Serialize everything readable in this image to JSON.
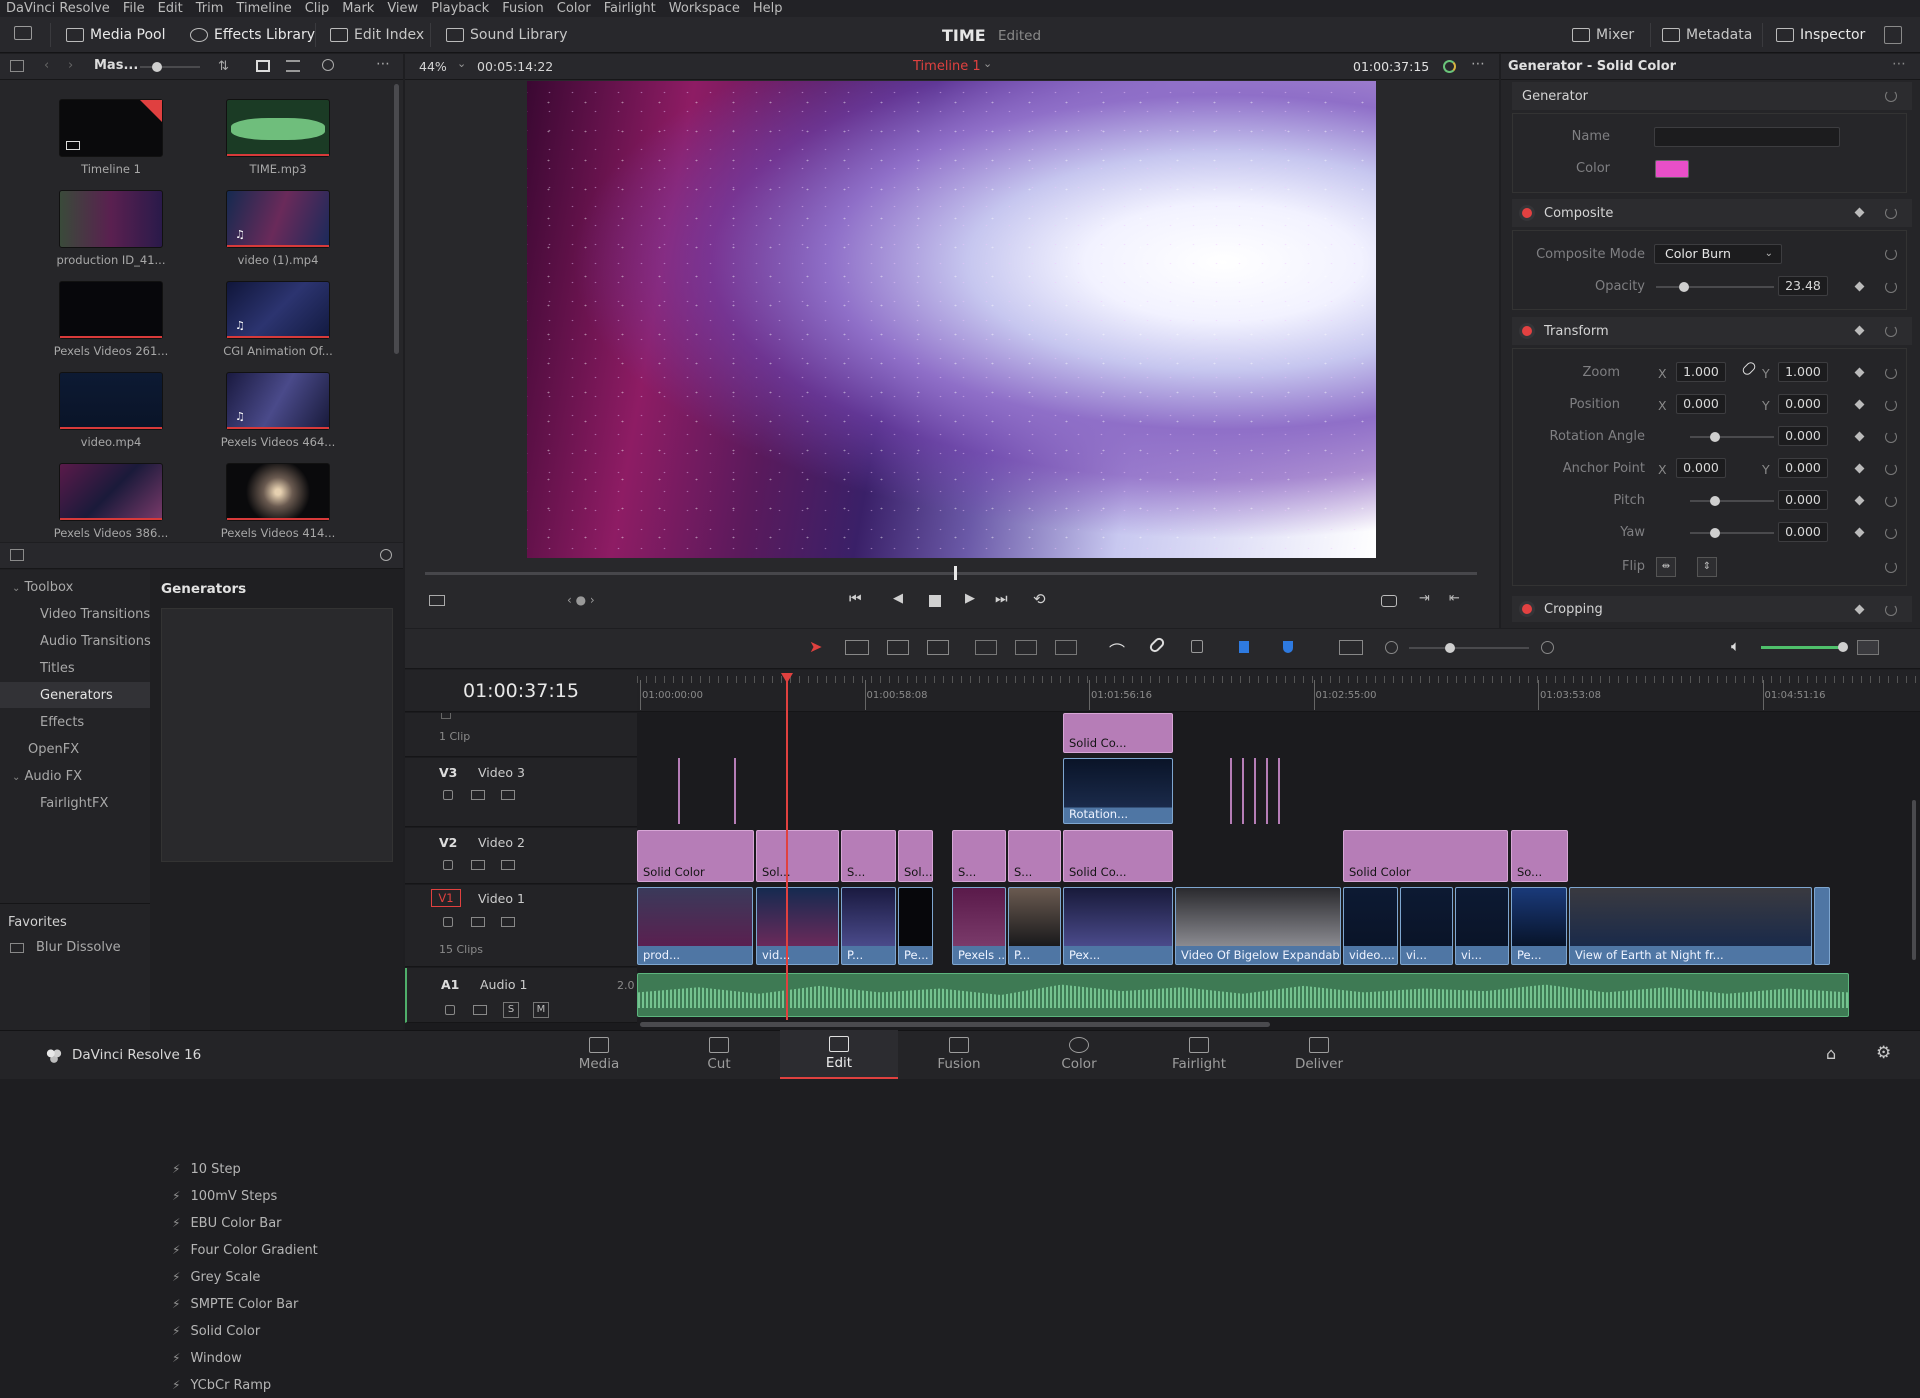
{
  "menu": [
    "DaVinci Resolve",
    "File",
    "Edit",
    "Trim",
    "Timeline",
    "Clip",
    "Mark",
    "View",
    "Playback",
    "Fusion",
    "Color",
    "Fairlight",
    "Workspace",
    "Help"
  ],
  "toolbar": {
    "media_pool": "Media Pool",
    "effects_library": "Effects Library",
    "edit_index": "Edit Index",
    "sound_library": "Sound Library",
    "project_title": "TIME",
    "project_status": "Edited",
    "mixer": "Mixer",
    "metadata": "Metadata",
    "inspector": "Inspector"
  },
  "media_pool": {
    "bin_label": "Mas...",
    "items": [
      {
        "name": "Timeline 1"
      },
      {
        "name": "TIME.mp3"
      },
      {
        "name": "production ID_41..."
      },
      {
        "name": "video (1).mp4"
      },
      {
        "name": "Pexels Videos 261..."
      },
      {
        "name": "CGI Animation Of..."
      },
      {
        "name": "video.mp4"
      },
      {
        "name": "Pexels Videos 464..."
      },
      {
        "name": "Pexels Videos 386..."
      },
      {
        "name": "Pexels Videos 414..."
      }
    ]
  },
  "effects": {
    "tree": {
      "toolbox": "Toolbox",
      "video_transitions": "Video Transitions",
      "audio_transitions": "Audio Transitions",
      "titles": "Titles",
      "generators": "Generators",
      "effects": "Effects",
      "openfx": "OpenFX",
      "audio_fx": "Audio FX",
      "fairlightfx": "FairlightFX"
    },
    "list_title": "Generators",
    "list": [
      "10 Step",
      "100mV Steps",
      "EBU Color Bar",
      "Four Color Gradient",
      "Grey Scale",
      "SMPTE Color Bar",
      "Solid Color",
      "Window",
      "YCbCr Ramp"
    ],
    "favorites_title": "Favorites",
    "favorites": [
      "Blur Dissolve"
    ]
  },
  "viewer": {
    "zoom": "44%",
    "duration": "00:05:14:22",
    "timeline_name": "Timeline 1",
    "timecode": "01:00:37:15",
    "scrub_position": 0.118
  },
  "inspector": {
    "title": "Generator - Solid Color",
    "generator": {
      "header": "Generator",
      "name_label": "Name",
      "name_value": "",
      "color_label": "Color",
      "color": "#e84fc8"
    },
    "composite": {
      "header": "Composite",
      "mode_label": "Composite Mode",
      "mode_value": "Color Burn",
      "opacity_label": "Opacity",
      "opacity_value": "23.48"
    },
    "transform": {
      "header": "Transform",
      "zoom_label": "Zoom",
      "zoom_x": "1.000",
      "zoom_y": "1.000",
      "position_label": "Position",
      "position_x": "0.000",
      "position_y": "0.000",
      "rotation_label": "Rotation Angle",
      "rotation_value": "0.000",
      "anchor_label": "Anchor Point",
      "anchor_x": "0.000",
      "anchor_y": "0.000",
      "pitch_label": "Pitch",
      "pitch_value": "0.000",
      "yaw_label": "Yaw",
      "yaw_value": "0.000",
      "flip_label": "Flip",
      "x": "X",
      "y": "Y"
    },
    "cropping": {
      "header": "Cropping"
    }
  },
  "timeline": {
    "timecode": "01:00:37:15",
    "ruler": [
      "01:00:00:00",
      "01:00:58:08",
      "01:01:56:16",
      "01:02:55:00",
      "01:03:53:08",
      "01:04:51:16"
    ],
    "tracks": {
      "v4_info": "1 Clip",
      "v3_id": "V3",
      "v3_name": "Video 3",
      "v2_id": "V2",
      "v2_name": "Video 2",
      "v1_id": "V1",
      "v1_name": "Video 1",
      "v1_info": "15 Clips",
      "a1_id": "A1",
      "a1_name": "Audio 1",
      "a1_level": "2.0",
      "solo": "S",
      "mute": "M"
    },
    "clips": {
      "v4": [
        "Solid Co..."
      ],
      "v3": [
        "Rotation..."
      ],
      "v2": [
        "Solid Color",
        "Sol...",
        "S...",
        "Sol...",
        "S...",
        "S...",
        "Solid Co...",
        "Solid Color",
        "So..."
      ],
      "v1": [
        "prod...",
        "vid...",
        "P...",
        "Pe...",
        "Pexels ...",
        "P...",
        "Pex...",
        "Video Of Bigelow Expandabl...",
        "video....",
        "vi...",
        "vi...",
        "Pe...",
        "View of Earth at Night fr..."
      ]
    }
  },
  "pages": [
    "Media",
    "Cut",
    "Edit",
    "Fusion",
    "Color",
    "Fairlight",
    "Deliver"
  ],
  "app_name": "DaVinci Resolve 16",
  "colors": {
    "accent_red": "#e0413f",
    "clip_pink": "#b67db7",
    "clip_blue": "#4f76a4",
    "audio_green": "#5db57e"
  }
}
